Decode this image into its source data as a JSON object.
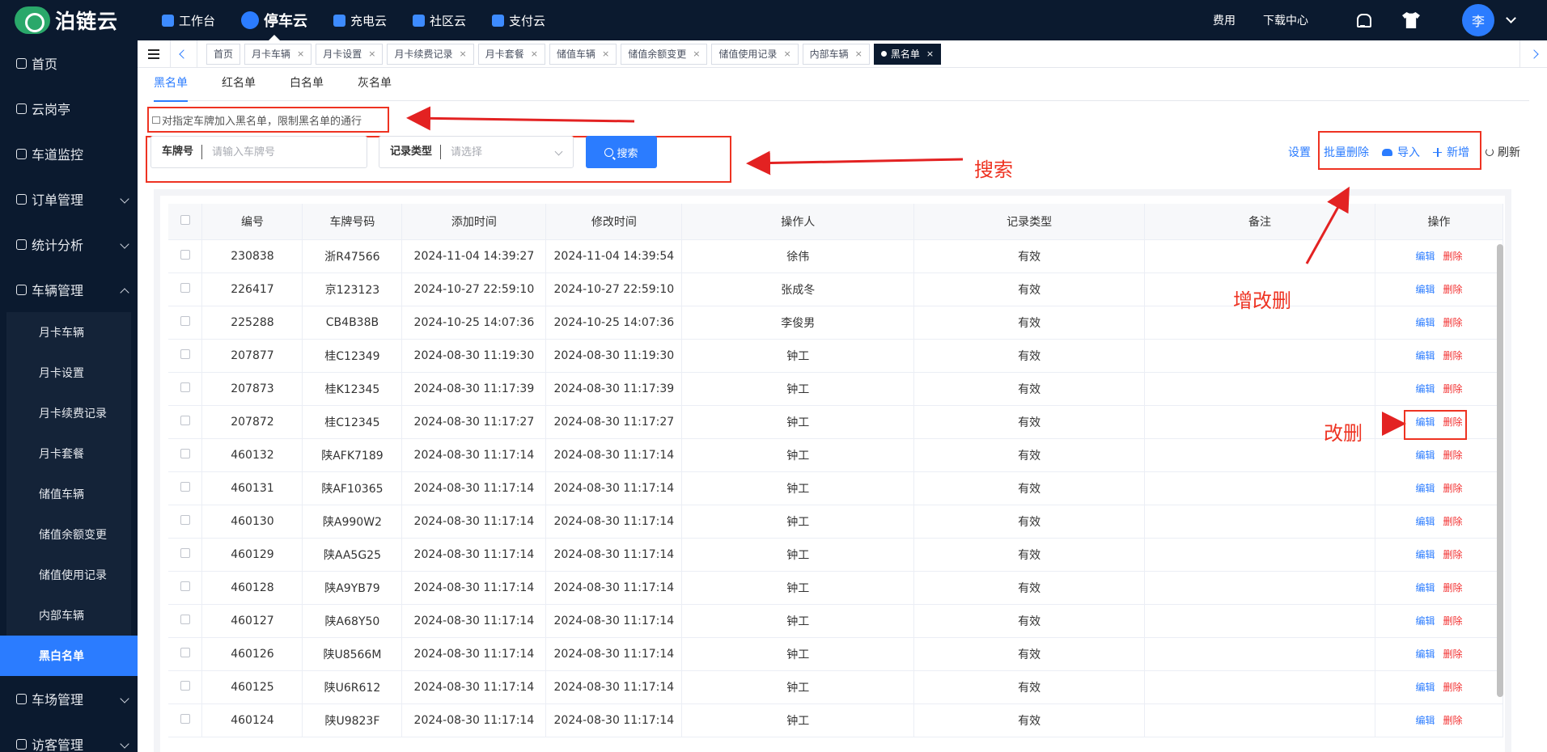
{
  "app": {
    "logo_text": "泊链云"
  },
  "topnav": [
    {
      "label": "工作台",
      "active": false
    },
    {
      "label": "停车云",
      "active": true
    },
    {
      "label": "充电云",
      "active": false
    },
    {
      "label": "社区云",
      "active": false
    },
    {
      "label": "支付云",
      "active": false
    }
  ],
  "topright": {
    "fees": "费用",
    "download": "下载中心",
    "avatar": "李"
  },
  "sidebar": {
    "items": [
      {
        "label": "首页"
      },
      {
        "label": "云岗亭"
      },
      {
        "label": "车道监控"
      },
      {
        "label": "订单管理"
      },
      {
        "label": "统计分析"
      },
      {
        "label": "车辆管理"
      }
    ],
    "sub_items": [
      {
        "label": "月卡车辆"
      },
      {
        "label": "月卡设置"
      },
      {
        "label": "月卡续费记录"
      },
      {
        "label": "月卡套餐"
      },
      {
        "label": "储值车辆"
      },
      {
        "label": "储值余额变更"
      },
      {
        "label": "储值使用记录"
      },
      {
        "label": "内部车辆"
      },
      {
        "label": "黑白名单"
      }
    ],
    "after_items": [
      {
        "label": "车场管理"
      },
      {
        "label": "访客管理"
      }
    ]
  },
  "tabs": [
    {
      "label": "首页",
      "closable": false
    },
    {
      "label": "月卡车辆",
      "closable": true
    },
    {
      "label": "月卡设置",
      "closable": true
    },
    {
      "label": "月卡续费记录",
      "closable": true
    },
    {
      "label": "月卡套餐",
      "closable": true
    },
    {
      "label": "储值车辆",
      "closable": true
    },
    {
      "label": "储值余额变更",
      "closable": true
    },
    {
      "label": "储值使用记录",
      "closable": true
    },
    {
      "label": "内部车辆",
      "closable": true
    },
    {
      "label": "黑名单",
      "closable": true
    }
  ],
  "subtabs": [
    {
      "label": "黑名单",
      "active": true
    },
    {
      "label": "红名单",
      "active": false
    },
    {
      "label": "白名单",
      "active": false
    },
    {
      "label": "灰名单",
      "active": false
    }
  ],
  "notice": "对指定车牌加入黑名单，限制黑名单的通行",
  "search": {
    "plate_label": "车牌号",
    "plate_placeholder": "请输入车牌号",
    "type_label": "记录类型",
    "type_placeholder": "请选择",
    "button": "搜索"
  },
  "toolbar": {
    "settings": "设置",
    "batch_delete": "批量删除",
    "import": "导入",
    "add": "新增",
    "refresh": "刷新"
  },
  "table": {
    "headers": [
      "编号",
      "车牌号码",
      "添加时间",
      "修改时间",
      "操作人",
      "记录类型",
      "备注",
      "操作"
    ],
    "edit_label": "编辑",
    "delete_label": "删除",
    "rows": [
      [
        "230838",
        "浙R47566",
        "2024-11-04 14:39:27",
        "2024-11-04 14:39:54",
        "徐伟",
        "有效",
        ""
      ],
      [
        "226417",
        "京123123",
        "2024-10-27 22:59:10",
        "2024-10-27 22:59:10",
        "张成冬",
        "有效",
        ""
      ],
      [
        "225288",
        "CB4B38B",
        "2024-10-25 14:07:36",
        "2024-10-25 14:07:36",
        "李俊男",
        "有效",
        ""
      ],
      [
        "207877",
        "桂C12349",
        "2024-08-30 11:19:30",
        "2024-08-30 11:19:30",
        "钟工",
        "有效",
        ""
      ],
      [
        "207873",
        "桂K12345",
        "2024-08-30 11:17:39",
        "2024-08-30 11:17:39",
        "钟工",
        "有效",
        ""
      ],
      [
        "207872",
        "桂C12345",
        "2024-08-30 11:17:27",
        "2024-08-30 11:17:27",
        "钟工",
        "有效",
        ""
      ],
      [
        "460132",
        "陕AFK7189",
        "2024-08-30 11:17:14",
        "2024-08-30 11:17:14",
        "钟工",
        "有效",
        ""
      ],
      [
        "460131",
        "陕AF10365",
        "2024-08-30 11:17:14",
        "2024-08-30 11:17:14",
        "钟工",
        "有效",
        ""
      ],
      [
        "460130",
        "陕A990W2",
        "2024-08-30 11:17:14",
        "2024-08-30 11:17:14",
        "钟工",
        "有效",
        ""
      ],
      [
        "460129",
        "陕AA5G25",
        "2024-08-30 11:17:14",
        "2024-08-30 11:17:14",
        "钟工",
        "有效",
        ""
      ],
      [
        "460128",
        "陕A9YB79",
        "2024-08-30 11:17:14",
        "2024-08-30 11:17:14",
        "钟工",
        "有效",
        ""
      ],
      [
        "460127",
        "陕A68Y50",
        "2024-08-30 11:17:14",
        "2024-08-30 11:17:14",
        "钟工",
        "有效",
        ""
      ],
      [
        "460126",
        "陕U8566M",
        "2024-08-30 11:17:14",
        "2024-08-30 11:17:14",
        "钟工",
        "有效",
        ""
      ],
      [
        "460125",
        "陕U6R612",
        "2024-08-30 11:17:14",
        "2024-08-30 11:17:14",
        "钟工",
        "有效",
        ""
      ],
      [
        "460124",
        "陕U9823F",
        "2024-08-30 11:17:14",
        "2024-08-30 11:17:14",
        "钟工",
        "有效",
        ""
      ]
    ]
  },
  "annotations": {
    "search": "搜索",
    "crud": "增改删",
    "edit_delete": "改删"
  },
  "colors": {
    "primary": "#2b7cff",
    "danger": "#f23030",
    "nav_bg": "#0b1a2f",
    "annotation": "#e32222"
  }
}
